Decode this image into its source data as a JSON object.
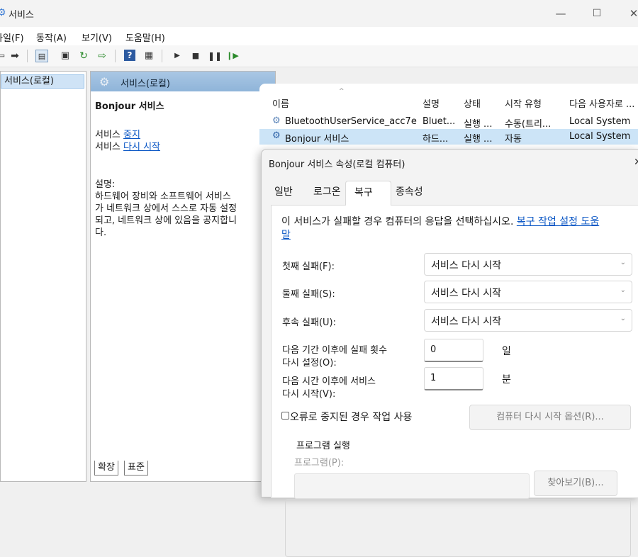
{
  "window": {
    "title": "서비스"
  },
  "menu": [
    "파일(F)",
    "동작(A)",
    "보기(V)",
    "도움말(H)"
  ],
  "toolbar": {
    "icons": [
      "back-icon",
      "forward-icon",
      "show-hide-tree-icon",
      "properties-icon",
      "refresh-icon",
      "export-list-icon",
      "help-icon",
      "console-icon",
      "start-icon",
      "stop-icon",
      "pause-icon",
      "resume-icon"
    ]
  },
  "tree": {
    "item": "서비스(로컬)"
  },
  "mid": {
    "header": "서비스(로컬)",
    "service_name": "Bonjour 서비스",
    "stop_prefix": "서비스 ",
    "stop_link": "중지",
    "restart_prefix": "서비스 ",
    "restart_link": "다시 시작",
    "desc_label": "설명:",
    "desc_lines": [
      "하드웨어 장비와 소프트웨어 서비스",
      "가 네트워크 상에서 스스로 자동 설정",
      "되고, 네트워크 상에 있음을 공지합니",
      "다."
    ]
  },
  "list": {
    "columns": [
      "이름",
      "설명",
      "상태",
      "시작 유형",
      "다음 사용자로 ..."
    ],
    "rows": [
      [
        "BluetoothUserService_acc7e",
        "Bluet...",
        "실행 ...",
        "수동(트리...",
        "Local System"
      ],
      [
        "Bonjour 서비스",
        "하드...",
        "실행 ...",
        "자동",
        "Local System"
      ]
    ]
  },
  "bottom_tabs": [
    "확장",
    "표준"
  ],
  "dialog": {
    "title": "Bonjour 서비스 속성(로컬 컴퓨터)",
    "close": "✕",
    "tabs": [
      "일반",
      "로그온",
      "복구",
      "종속성"
    ],
    "active_tab": "복구",
    "intro_text": "이 서비스가 실패할 경우 컴퓨터의 응답을 선택하십시오. ",
    "intro_link_1": "복구 작업 설정 도움",
    "intro_link_2": "말",
    "first_failure": {
      "label": "첫째 실패(F):",
      "value": "서비스 다시 시작"
    },
    "second_failure": {
      "label": "둘째 실패(S):",
      "value": "서비스 다시 시작"
    },
    "subsequent_failure": {
      "label": "후속 실패(U):",
      "value": "서비스 다시 시작"
    },
    "reset_count": {
      "label_1": "다음 기간 이후에 실패 횟수",
      "label_2": "다시 설정(O):",
      "value": "0",
      "unit": "일"
    },
    "restart_after": {
      "label_1": "다음 시간 이후에 서비스",
      "label_2": "다시 시작(V):",
      "value": "1",
      "unit": "분"
    },
    "enable_actions": {
      "label": "오류로 중지된 경우 작업 사용",
      "checked": false
    },
    "restart_computer_button": "컴퓨터 다시 시작 옵션(R)...",
    "run_program": {
      "group": "프로그램 실행",
      "program_label": "프로그램(P):",
      "browse": "찾아보기(B)..."
    }
  }
}
